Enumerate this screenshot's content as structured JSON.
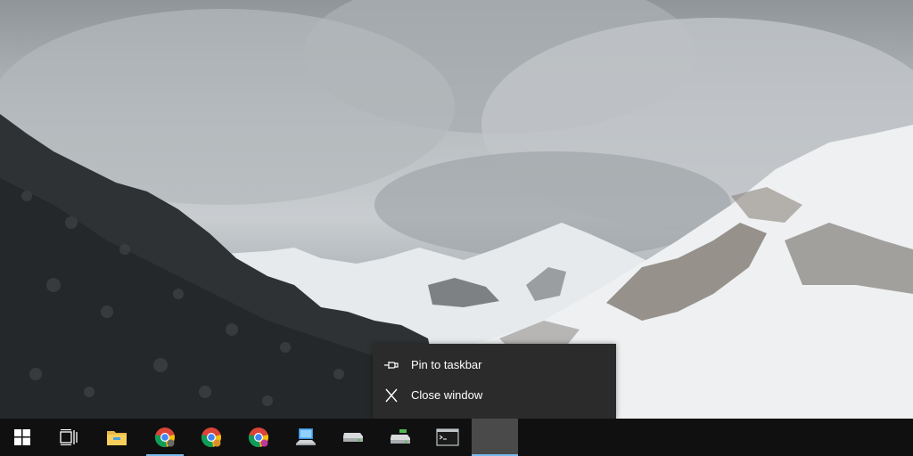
{
  "context_menu": {
    "items": [
      {
        "label": "Pin to taskbar",
        "icon": "pin-icon"
      },
      {
        "label": "Close window",
        "icon": "close-icon"
      }
    ]
  },
  "taskbar": {
    "buttons": [
      {
        "icon": "windows-start-icon"
      },
      {
        "icon": "task-view-icon"
      },
      {
        "icon": "file-explorer-icon"
      },
      {
        "icon": "chrome-icon",
        "active": true
      },
      {
        "icon": "chrome-icon",
        "active": false
      },
      {
        "icon": "chrome-icon",
        "active": false
      },
      {
        "icon": "network-computer-icon"
      },
      {
        "icon": "drive-icon"
      },
      {
        "icon": "drive-green-icon"
      },
      {
        "icon": "command-prompt-icon"
      },
      {
        "icon": "empty-hovered-window"
      }
    ],
    "accent_color": "#76b9ed"
  }
}
